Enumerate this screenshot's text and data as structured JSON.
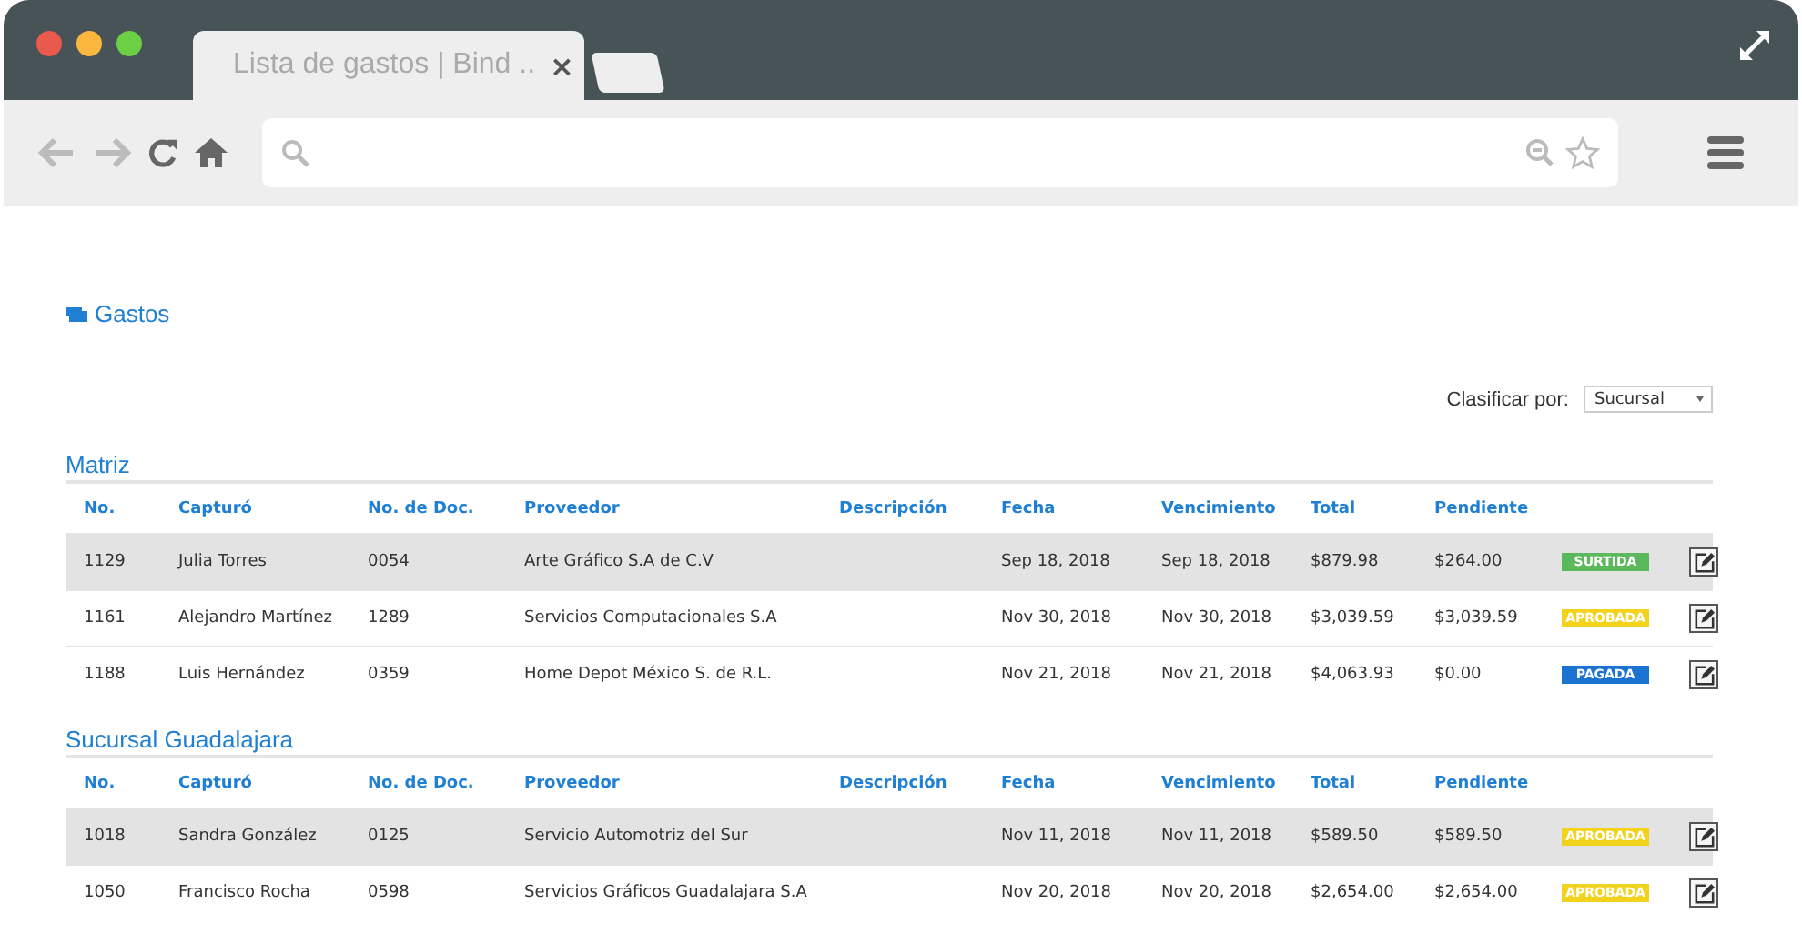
{
  "browser": {
    "tab_title": "Lista de gastos | Bind ..",
    "close": "×"
  },
  "page": {
    "breadcrumb": "Gastos",
    "sort": {
      "label": "Clasificar por:",
      "value": "Sucursal"
    },
    "groups": [
      {
        "title": "Matriz",
        "columns": [
          "No.",
          "Capturó",
          "No. de Doc.",
          "Proveedor",
          "Descripción",
          "Fecha",
          "Vencimiento",
          "Total",
          "Pendiente"
        ],
        "rows": [
          {
            "highlighted": true,
            "cells": [
              "1129",
              "Julia Torres",
              "0054",
              "Arte Gráfico S.A de C.V",
              "",
              "Sep 18, 2018",
              "Sep 18, 2018",
              "$879.98",
              "$264.00"
            ],
            "status": {
              "label": "SURTIDA",
              "color": "#5cb85c"
            }
          },
          {
            "highlighted": false,
            "cells": [
              "1161",
              "Alejandro Martínez",
              "1289",
              "Servicios Computacionales S.A",
              "",
              "Nov 30, 2018",
              "Nov 30, 2018",
              "$3,039.59",
              "$3,039.59"
            ],
            "status": {
              "label": "APROBADA",
              "color": "#f2d21b"
            }
          },
          {
            "highlighted": false,
            "cells": [
              "1188",
              "Luis Hernández",
              "0359",
              "Home Depot México S. de R.L.",
              "",
              "Nov 21, 2018",
              "Nov 21, 2018",
              "$4,063.93",
              "$0.00"
            ],
            "status": {
              "label": "PAGADA",
              "color": "#1a73d0"
            }
          }
        ]
      },
      {
        "title": "Sucursal Guadalajara",
        "columns": [
          "No.",
          "Capturó",
          "No. de Doc.",
          "Proveedor",
          "Descripción",
          "Fecha",
          "Vencimiento",
          "Total",
          "Pendiente"
        ],
        "rows": [
          {
            "highlighted": true,
            "cells": [
              "1018",
              "Sandra González",
              "0125",
              "Servicio Automotriz del Sur",
              "",
              "Nov 11, 2018",
              "Nov 11, 2018",
              "$589.50",
              "$589.50"
            ],
            "status": {
              "label": "APROBADA",
              "color": "#f2d21b"
            }
          },
          {
            "highlighted": false,
            "cells": [
              "1050",
              "Francisco Rocha",
              "0598",
              "Servicios Gráficos Guadalajara S.A",
              "",
              "Nov 20, 2018",
              "Nov 20, 2018",
              "$2,654.00",
              "$2,654.00"
            ],
            "status": {
              "label": "APROBADA",
              "color": "#f2d21b"
            }
          }
        ]
      }
    ]
  }
}
